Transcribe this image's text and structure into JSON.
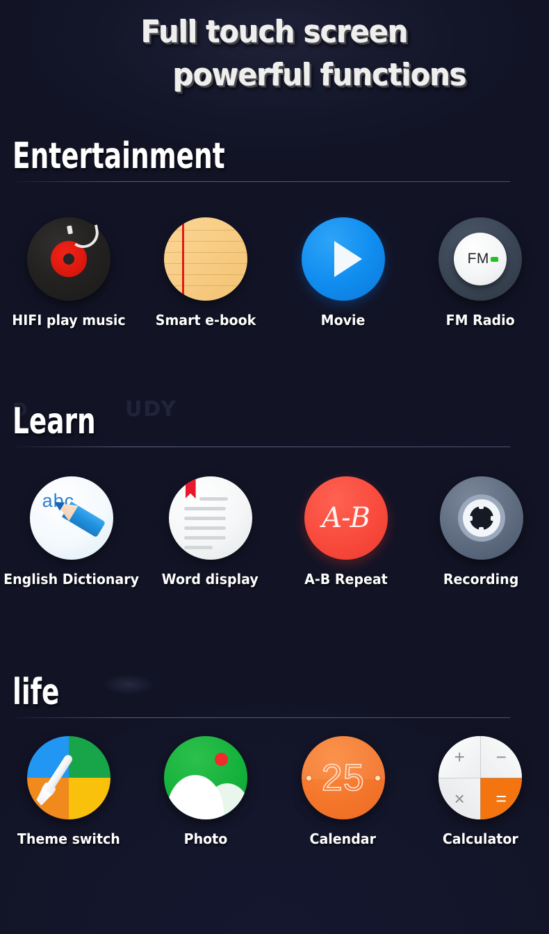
{
  "theme": {
    "background_color": "#13152a",
    "text_color": "#ffffff",
    "accent_colors": {
      "movie_blue": "#118ef0",
      "ab_repeat_red": "#f84a3d",
      "photo_green": "#14b23c",
      "calendar_orange": "#f4762b",
      "calculator_orange": "#f4740f",
      "fm_green": "#1fc21f",
      "vinyl_red": "#d9160c",
      "notebook_tan": "#f8cd86",
      "dictionary_blue": "#2f7fd0",
      "bookmark_red": "#e8192c"
    }
  },
  "hero": {
    "line1": "Full touch screen",
    "line2": "powerful functions"
  },
  "sections": [
    {
      "title": "Entertainment",
      "ghost": "",
      "items": [
        {
          "label": "HIFI play music",
          "icon": "vinyl-record-icon"
        },
        {
          "label": "Smart e-book",
          "icon": "notebook-paper-icon"
        },
        {
          "label": "Movie",
          "icon": "play-button-icon"
        },
        {
          "label": "FM Radio",
          "icon": "fm-radio-dial-icon",
          "badge": "FM"
        }
      ]
    },
    {
      "title": "Learn",
      "ghost": "UDY",
      "ghost2": "D",
      "items": [
        {
          "label": "English Dictionary",
          "icon": "pencil-abc-icon",
          "badge": "abc"
        },
        {
          "label": "Word display",
          "icon": "document-bookmark-icon"
        },
        {
          "label": "A-B Repeat",
          "icon": "ab-repeat-icon",
          "badge": "A-B"
        },
        {
          "label": "Recording",
          "icon": "recording-reel-icon"
        }
      ]
    },
    {
      "title": "life",
      "ghost": "",
      "items": [
        {
          "label": "Theme switch",
          "icon": "paintbrush-palette-icon"
        },
        {
          "label": "Photo",
          "icon": "landscape-photo-icon"
        },
        {
          "label": "Calendar",
          "icon": "calendar-day-icon",
          "badge": "25"
        },
        {
          "label": "Calculator",
          "icon": "calculator-icon",
          "badge": "="
        }
      ]
    }
  ],
  "calculator_keys": {
    "plus": "+",
    "minus": "−",
    "times": "×",
    "equals": "="
  }
}
